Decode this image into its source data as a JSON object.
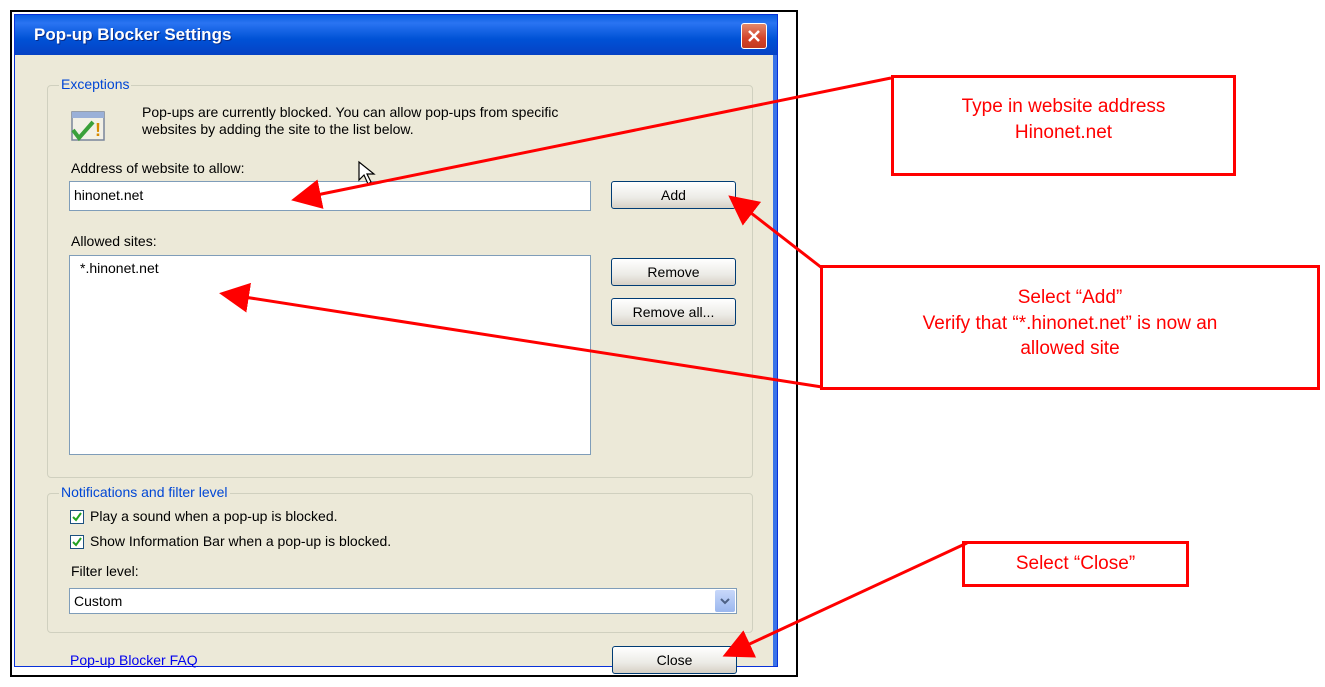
{
  "dialog": {
    "title": "Pop-up Blocker Settings",
    "exceptions": {
      "legend": "Exceptions",
      "info_line1": "Pop-ups are currently blocked.  You can allow pop-ups from specific",
      "info_line2": "websites by adding the site to the list below.",
      "address_label": "Address of website to allow:",
      "address_value": "hinonet.net",
      "add_label": "Add",
      "allowed_label": "Allowed sites:",
      "allowed_sites": [
        "*.hinonet.net"
      ],
      "remove_label": "Remove",
      "remove_all_label": "Remove all..."
    },
    "notifications": {
      "legend": "Notifications and filter level",
      "play_sound_label": "Play a sound when a pop-up is blocked.",
      "play_sound_checked": true,
      "show_infobar_label": "Show Information Bar when a pop-up is blocked.",
      "show_infobar_checked": true,
      "filter_label": "Filter level:",
      "filter_value": "Custom"
    },
    "faq_link": "Pop-up Blocker FAQ",
    "close_label": "Close"
  },
  "callouts": {
    "type_address_line1": "Type in website address",
    "type_address_line2": "Hinonet.net",
    "select_add_line1": "Select “Add”",
    "select_add_line2": "Verify that “*.hinonet.net” is now an",
    "select_add_line3": "allowed site",
    "select_close": "Select “Close”"
  },
  "colors": {
    "accent": "#ff0000",
    "titlebar": "#0a5fe0",
    "dialog_bg": "#ece9d8",
    "legend_text": "#0046d5"
  }
}
